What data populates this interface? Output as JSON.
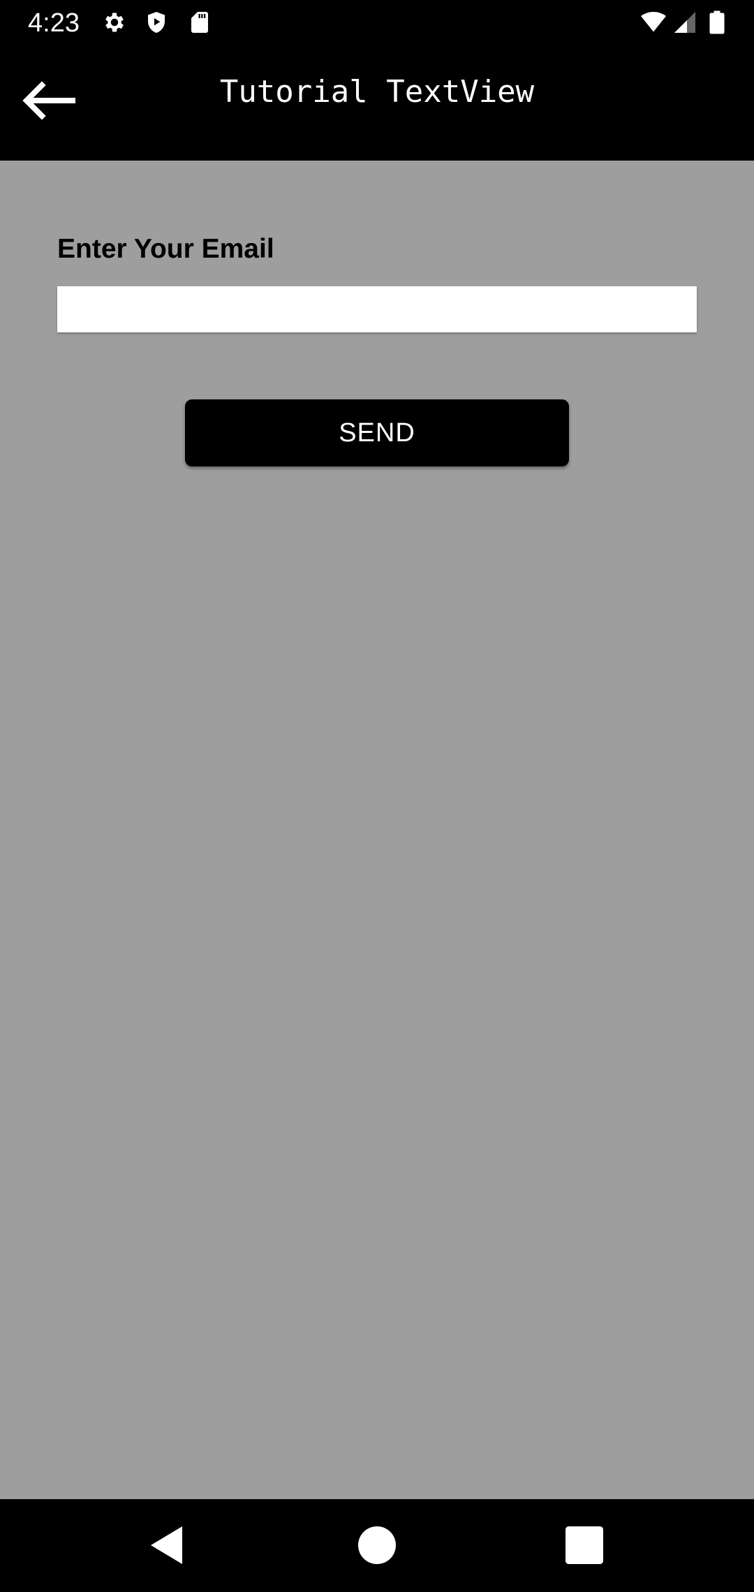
{
  "status_bar": {
    "time": "4:23",
    "left_icons": [
      "settings-icon",
      "shield-play-icon",
      "sd-card-icon"
    ],
    "right_icons": [
      "wifi-icon",
      "cell-signal-icon",
      "battery-icon"
    ]
  },
  "app_bar": {
    "title": "Tutorial TextView",
    "back_icon": "arrow-back-icon"
  },
  "form": {
    "email_label": "Enter Your Email",
    "email_value": "",
    "email_placeholder": "",
    "send_label": "SEND"
  },
  "nav_bar": {
    "icons": [
      "nav-back-icon",
      "nav-home-icon",
      "nav-recents-icon"
    ]
  },
  "colors": {
    "background": "#9e9e9e",
    "bars": "#000000",
    "button": "#000000",
    "button_text": "#ffffff",
    "input": "#ffffff"
  }
}
